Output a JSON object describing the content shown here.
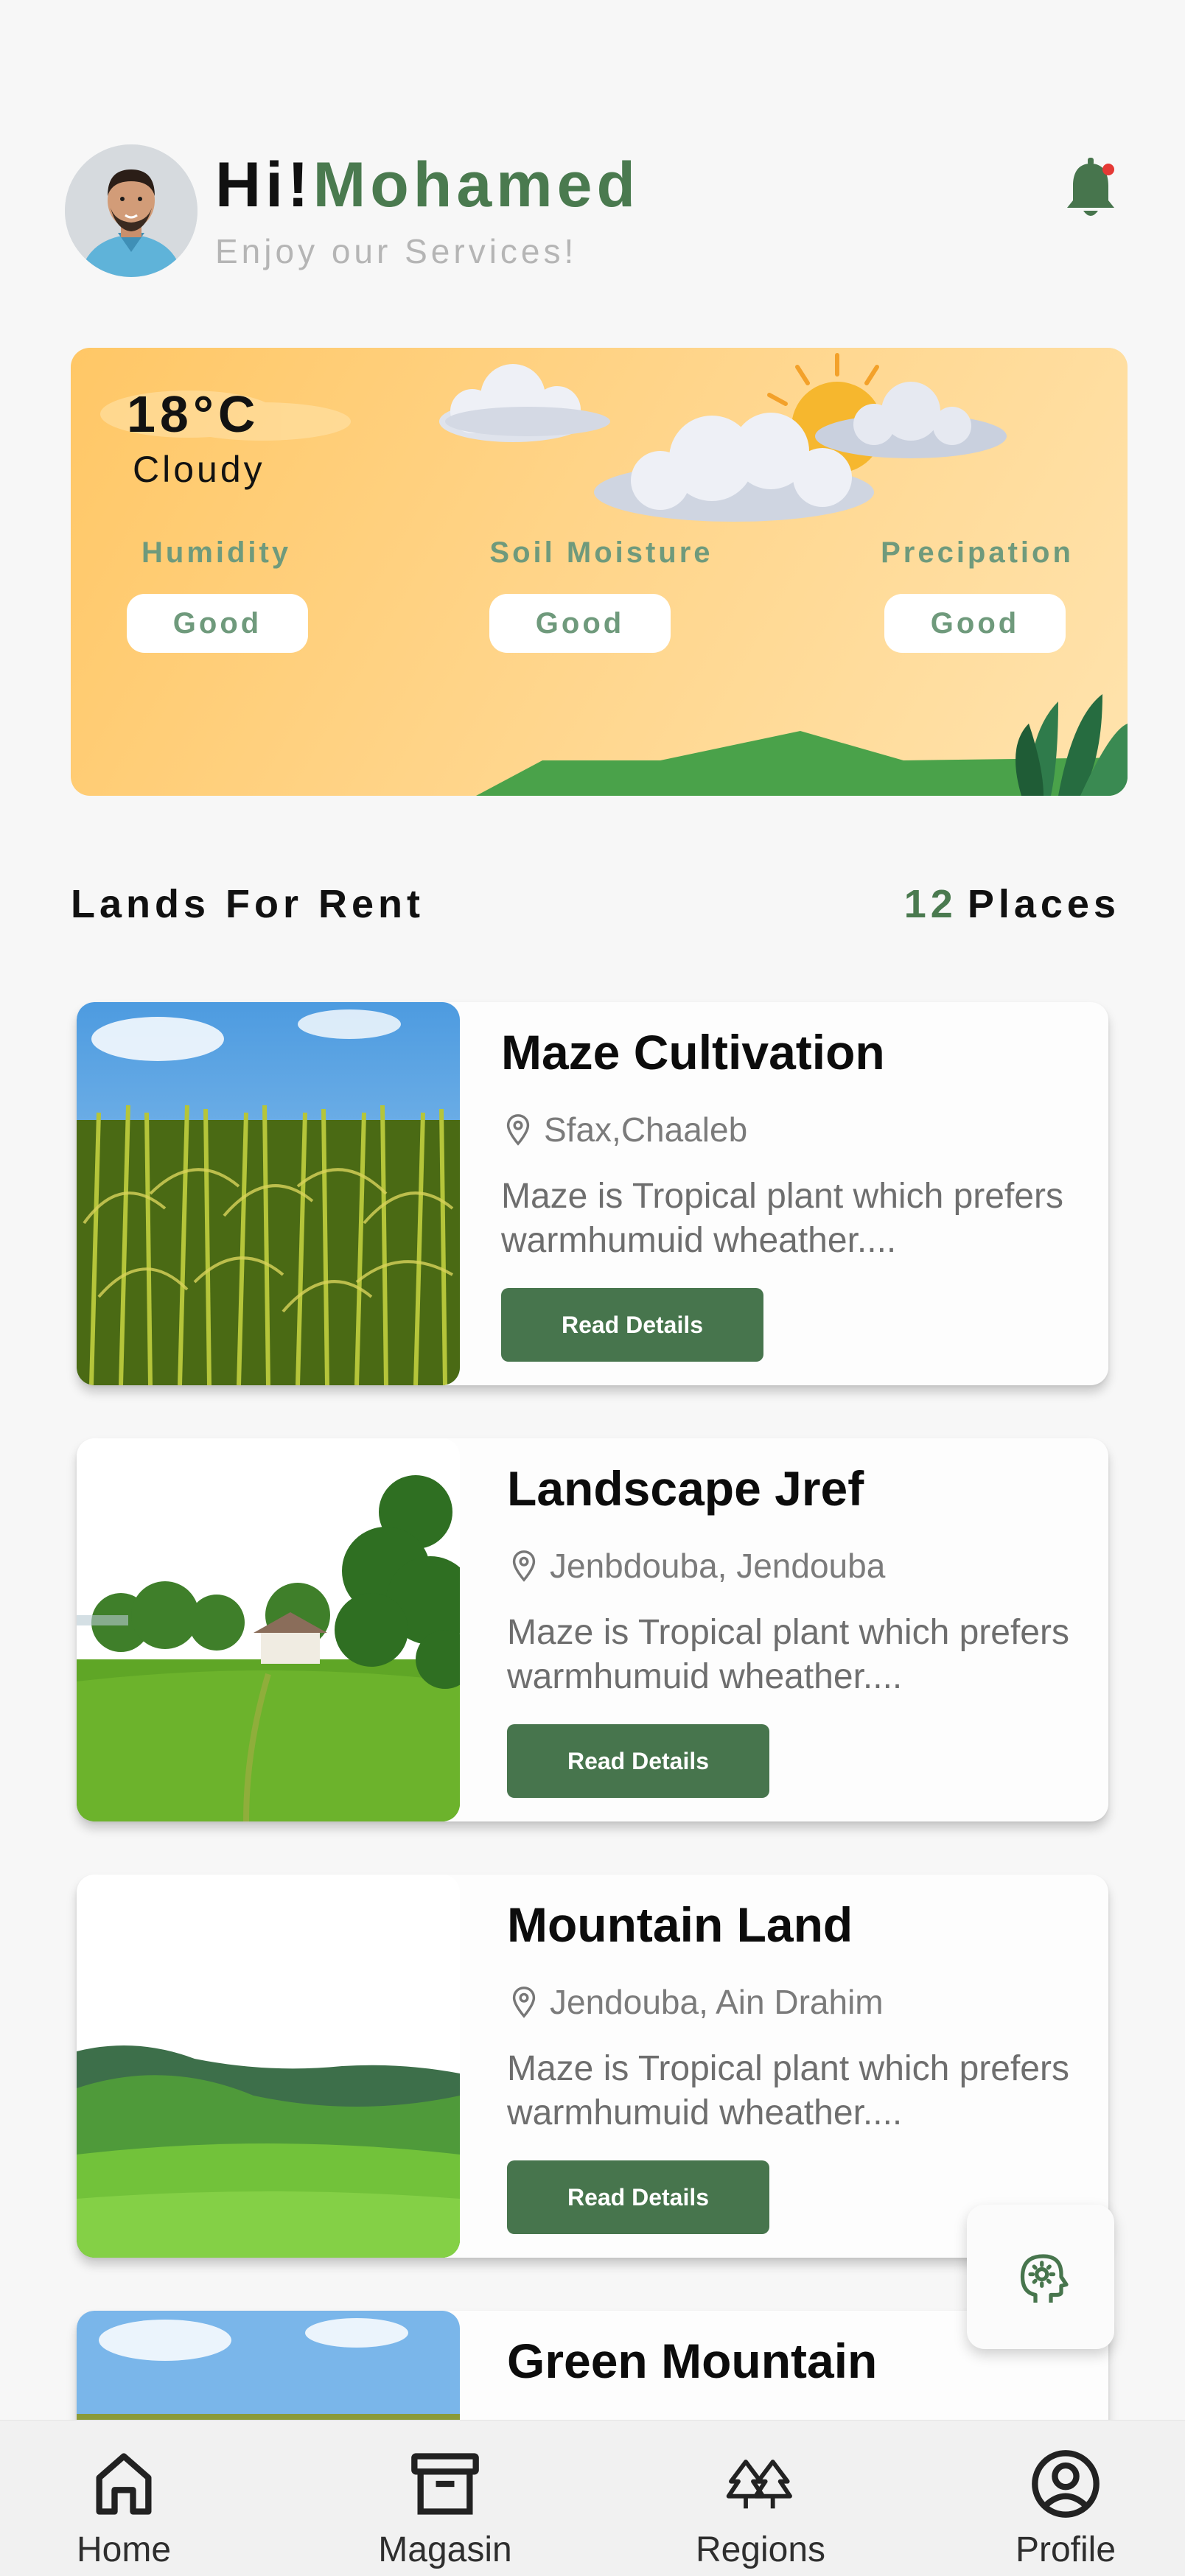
{
  "header": {
    "greeting": "Hi!",
    "name": "Mohamed",
    "subtitle": "Enjoy our Services!",
    "notification_icon": "bell-icon",
    "notification_badge_color": "#e53935"
  },
  "weather": {
    "temperature": "18°C",
    "condition": "Cloudy",
    "metrics": [
      {
        "label": "Humidity",
        "value": "Good"
      },
      {
        "label": "Soil Moisture",
        "value": "Good"
      },
      {
        "label": "Precipation",
        "value": "Good"
      }
    ]
  },
  "section": {
    "title": "Lands For Rent",
    "count": "12",
    "count_suffix": "Places"
  },
  "lands": [
    {
      "title": "Maze Cultivation",
      "location": "Sfax,Chaaleb",
      "description": "Maze is Tropical plant which prefers warmhumuid wheather....",
      "button": "Read Details"
    },
    {
      "title": "Landscape Jref",
      "location": "Jenbdouba, Jendouba",
      "description": "Maze is Tropical plant which prefers warmhumuid wheather....",
      "button": "Read Details"
    },
    {
      "title": "Mountain Land",
      "location": "Jendouba, Ain Drahim",
      "description": "Maze is Tropical plant which prefers warmhumuid wheather....",
      "button": "Read Details"
    },
    {
      "title": "Green Mountain"
    }
  ],
  "fab": {
    "icon": "brain-gear-icon"
  },
  "nav": [
    {
      "label": "Home",
      "icon": "home-icon"
    },
    {
      "label": "Magasin",
      "icon": "archive-icon"
    },
    {
      "label": "Regions",
      "icon": "trees-icon"
    },
    {
      "label": "Profile",
      "icon": "user-circle-icon"
    }
  ],
  "colors": {
    "brand_green": "#47754d",
    "accent_green": "#4a7a4f",
    "metric_green": "#6f9a7c",
    "weather_orange": "#ffc766"
  }
}
